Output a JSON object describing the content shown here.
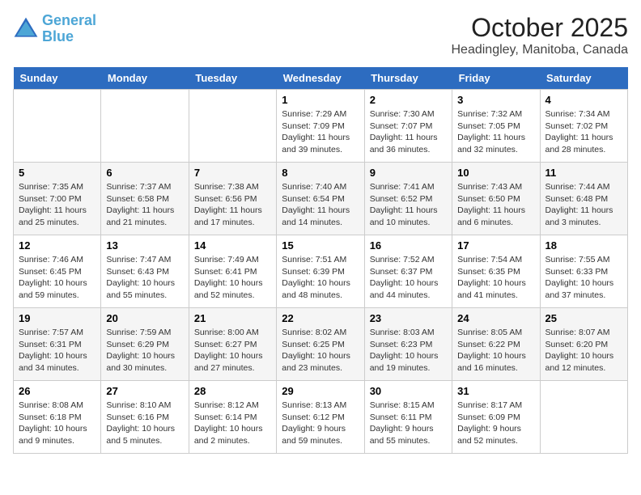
{
  "header": {
    "logo_line1": "General",
    "logo_line2": "Blue",
    "month": "October 2025",
    "location": "Headingley, Manitoba, Canada"
  },
  "days": [
    "Sunday",
    "Monday",
    "Tuesday",
    "Wednesday",
    "Thursday",
    "Friday",
    "Saturday"
  ],
  "weeks": [
    [
      {
        "date": "",
        "lines": []
      },
      {
        "date": "",
        "lines": []
      },
      {
        "date": "",
        "lines": []
      },
      {
        "date": "1",
        "lines": [
          "Sunrise: 7:29 AM",
          "Sunset: 7:09 PM",
          "Daylight: 11 hours",
          "and 39 minutes."
        ]
      },
      {
        "date": "2",
        "lines": [
          "Sunrise: 7:30 AM",
          "Sunset: 7:07 PM",
          "Daylight: 11 hours",
          "and 36 minutes."
        ]
      },
      {
        "date": "3",
        "lines": [
          "Sunrise: 7:32 AM",
          "Sunset: 7:05 PM",
          "Daylight: 11 hours",
          "and 32 minutes."
        ]
      },
      {
        "date": "4",
        "lines": [
          "Sunrise: 7:34 AM",
          "Sunset: 7:02 PM",
          "Daylight: 11 hours",
          "and 28 minutes."
        ]
      }
    ],
    [
      {
        "date": "5",
        "lines": [
          "Sunrise: 7:35 AM",
          "Sunset: 7:00 PM",
          "Daylight: 11 hours",
          "and 25 minutes."
        ]
      },
      {
        "date": "6",
        "lines": [
          "Sunrise: 7:37 AM",
          "Sunset: 6:58 PM",
          "Daylight: 11 hours",
          "and 21 minutes."
        ]
      },
      {
        "date": "7",
        "lines": [
          "Sunrise: 7:38 AM",
          "Sunset: 6:56 PM",
          "Daylight: 11 hours",
          "and 17 minutes."
        ]
      },
      {
        "date": "8",
        "lines": [
          "Sunrise: 7:40 AM",
          "Sunset: 6:54 PM",
          "Daylight: 11 hours",
          "and 14 minutes."
        ]
      },
      {
        "date": "9",
        "lines": [
          "Sunrise: 7:41 AM",
          "Sunset: 6:52 PM",
          "Daylight: 11 hours",
          "and 10 minutes."
        ]
      },
      {
        "date": "10",
        "lines": [
          "Sunrise: 7:43 AM",
          "Sunset: 6:50 PM",
          "Daylight: 11 hours",
          "and 6 minutes."
        ]
      },
      {
        "date": "11",
        "lines": [
          "Sunrise: 7:44 AM",
          "Sunset: 6:48 PM",
          "Daylight: 11 hours",
          "and 3 minutes."
        ]
      }
    ],
    [
      {
        "date": "12",
        "lines": [
          "Sunrise: 7:46 AM",
          "Sunset: 6:45 PM",
          "Daylight: 10 hours",
          "and 59 minutes."
        ]
      },
      {
        "date": "13",
        "lines": [
          "Sunrise: 7:47 AM",
          "Sunset: 6:43 PM",
          "Daylight: 10 hours",
          "and 55 minutes."
        ]
      },
      {
        "date": "14",
        "lines": [
          "Sunrise: 7:49 AM",
          "Sunset: 6:41 PM",
          "Daylight: 10 hours",
          "and 52 minutes."
        ]
      },
      {
        "date": "15",
        "lines": [
          "Sunrise: 7:51 AM",
          "Sunset: 6:39 PM",
          "Daylight: 10 hours",
          "and 48 minutes."
        ]
      },
      {
        "date": "16",
        "lines": [
          "Sunrise: 7:52 AM",
          "Sunset: 6:37 PM",
          "Daylight: 10 hours",
          "and 44 minutes."
        ]
      },
      {
        "date": "17",
        "lines": [
          "Sunrise: 7:54 AM",
          "Sunset: 6:35 PM",
          "Daylight: 10 hours",
          "and 41 minutes."
        ]
      },
      {
        "date": "18",
        "lines": [
          "Sunrise: 7:55 AM",
          "Sunset: 6:33 PM",
          "Daylight: 10 hours",
          "and 37 minutes."
        ]
      }
    ],
    [
      {
        "date": "19",
        "lines": [
          "Sunrise: 7:57 AM",
          "Sunset: 6:31 PM",
          "Daylight: 10 hours",
          "and 34 minutes."
        ]
      },
      {
        "date": "20",
        "lines": [
          "Sunrise: 7:59 AM",
          "Sunset: 6:29 PM",
          "Daylight: 10 hours",
          "and 30 minutes."
        ]
      },
      {
        "date": "21",
        "lines": [
          "Sunrise: 8:00 AM",
          "Sunset: 6:27 PM",
          "Daylight: 10 hours",
          "and 27 minutes."
        ]
      },
      {
        "date": "22",
        "lines": [
          "Sunrise: 8:02 AM",
          "Sunset: 6:25 PM",
          "Daylight: 10 hours",
          "and 23 minutes."
        ]
      },
      {
        "date": "23",
        "lines": [
          "Sunrise: 8:03 AM",
          "Sunset: 6:23 PM",
          "Daylight: 10 hours",
          "and 19 minutes."
        ]
      },
      {
        "date": "24",
        "lines": [
          "Sunrise: 8:05 AM",
          "Sunset: 6:22 PM",
          "Daylight: 10 hours",
          "and 16 minutes."
        ]
      },
      {
        "date": "25",
        "lines": [
          "Sunrise: 8:07 AM",
          "Sunset: 6:20 PM",
          "Daylight: 10 hours",
          "and 12 minutes."
        ]
      }
    ],
    [
      {
        "date": "26",
        "lines": [
          "Sunrise: 8:08 AM",
          "Sunset: 6:18 PM",
          "Daylight: 10 hours",
          "and 9 minutes."
        ]
      },
      {
        "date": "27",
        "lines": [
          "Sunrise: 8:10 AM",
          "Sunset: 6:16 PM",
          "Daylight: 10 hours",
          "and 5 minutes."
        ]
      },
      {
        "date": "28",
        "lines": [
          "Sunrise: 8:12 AM",
          "Sunset: 6:14 PM",
          "Daylight: 10 hours",
          "and 2 minutes."
        ]
      },
      {
        "date": "29",
        "lines": [
          "Sunrise: 8:13 AM",
          "Sunset: 6:12 PM",
          "Daylight: 9 hours",
          "and 59 minutes."
        ]
      },
      {
        "date": "30",
        "lines": [
          "Sunrise: 8:15 AM",
          "Sunset: 6:11 PM",
          "Daylight: 9 hours",
          "and 55 minutes."
        ]
      },
      {
        "date": "31",
        "lines": [
          "Sunrise: 8:17 AM",
          "Sunset: 6:09 PM",
          "Daylight: 9 hours",
          "and 52 minutes."
        ]
      },
      {
        "date": "",
        "lines": []
      }
    ]
  ]
}
